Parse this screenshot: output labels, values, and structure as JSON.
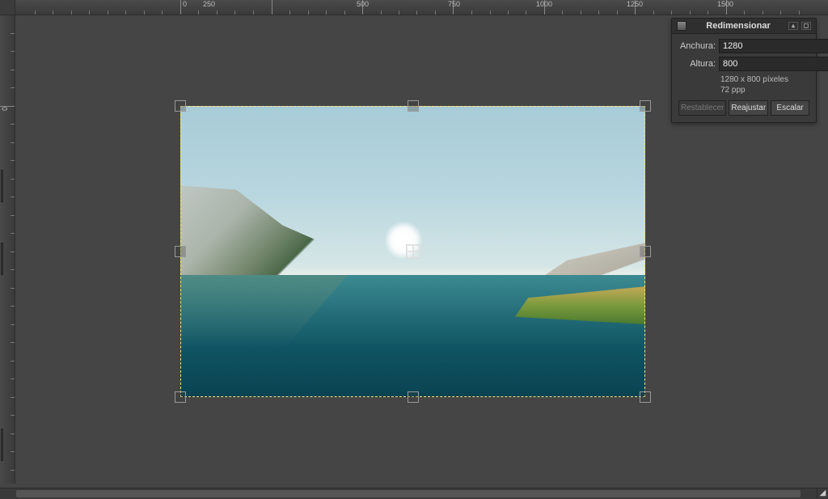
{
  "ruler": {
    "top_ticks": [
      "0",
      "250",
      "500",
      "750",
      "1000",
      "1250",
      "1500"
    ],
    "left_ticks": [
      "0"
    ]
  },
  "panel": {
    "title": "Redimensionar",
    "width_label": "Anchura:",
    "height_label": "Altura:",
    "width_value": "1280",
    "height_value": "800",
    "unit": "px",
    "info_dims": "1280 x 800 píxeles",
    "info_ppi": "72 ppp",
    "btn_reset": "Restablecer",
    "btn_readjust": "Reajustar",
    "btn_scale": "Escalar"
  },
  "canvas": {
    "image_desc": "landscape-photo"
  }
}
